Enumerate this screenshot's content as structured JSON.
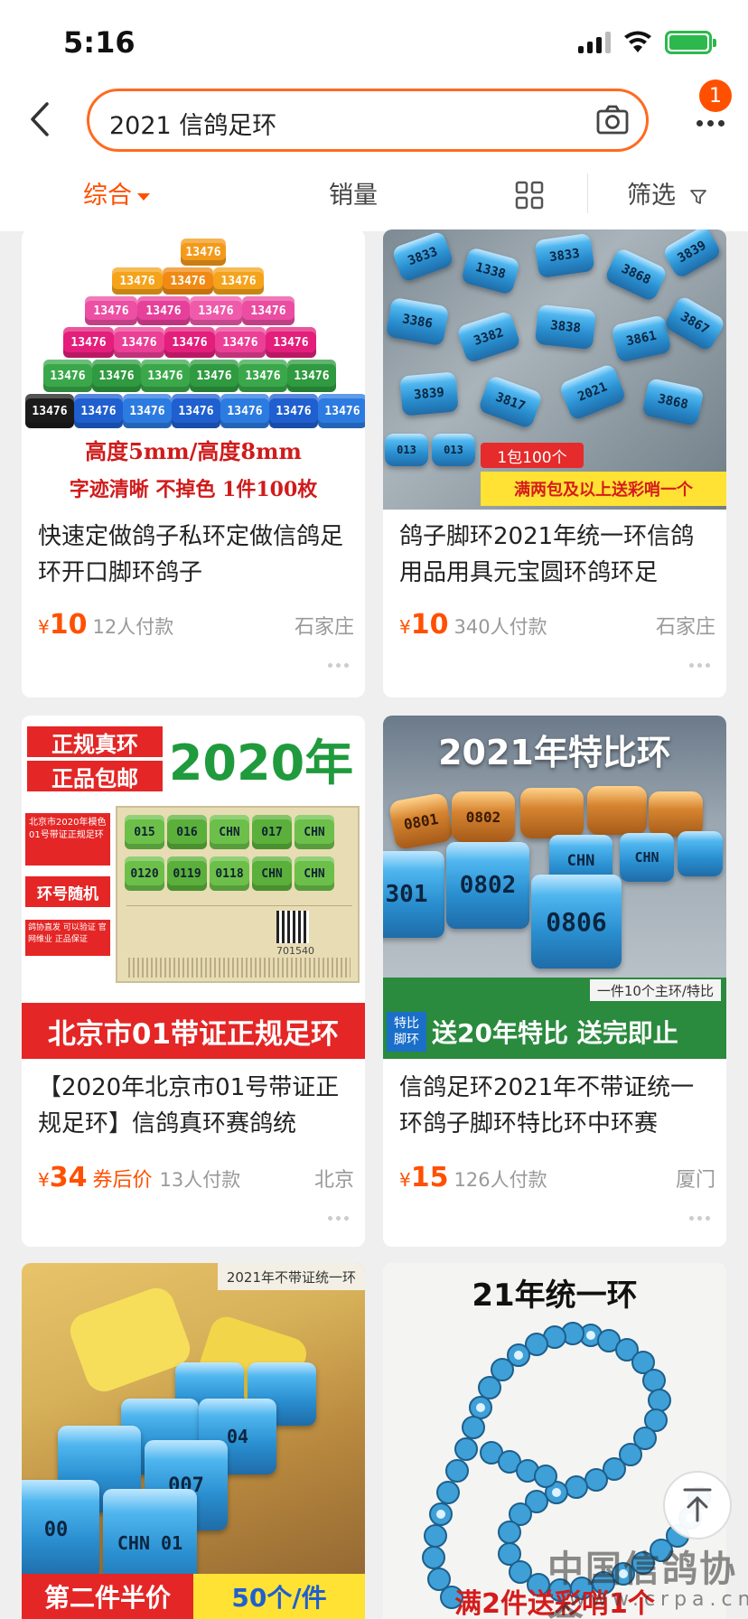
{
  "status_bar": {
    "time": "5:16"
  },
  "search": {
    "query": "2021 信鸽足环",
    "notification_count": "1"
  },
  "sort_bar": {
    "comprehensive": "综合",
    "sales": "销量",
    "filter": "筛选"
  },
  "products": [
    {
      "title": "快速定做鸽子私环定做信鸽足环开口脚环鸽子",
      "price_symbol": "¥",
      "price": "10",
      "coupon_label": "",
      "sales": "12人付款",
      "location": "石家庄",
      "image_text": {
        "line1": "高度5mm/高度8mm",
        "line2": "字迹清晰 不掉色 1件100枚",
        "ring_number": "13476"
      }
    },
    {
      "title": "鸽子脚环2021年统一环信鸽用品用具元宝圆环鸽环足",
      "price_symbol": "¥",
      "price": "10",
      "coupon_label": "",
      "sales": "340人付款",
      "location": "石家庄",
      "image_text": {
        "pack_label": "1包100个",
        "promo_banner": "满两包及以上送彩哨一个"
      }
    },
    {
      "title": "【2020年北京市01号带证正规足环】信鸽真环赛鸽统",
      "price_symbol": "¥",
      "price": "34",
      "coupon_label": "券后价",
      "sales": "13人付款",
      "location": "北京",
      "image_text": {
        "genuine_line1": "正规真环",
        "genuine_line2": "正品包邮",
        "year_headline": "2020年",
        "side_note1": "北京市2020年模色01号带证正规足环",
        "side_note2": "环号随机",
        "side_note3": "鸽协直发 可以验证 官网维业 正品保证",
        "bottom_banner": "北京市01带证正规足环",
        "cert_number": "701540"
      }
    },
    {
      "title": "信鸽足环2021年不带证统一环鸽子脚环特比环中环赛",
      "price_symbol": "¥",
      "price": "15",
      "coupon_label": "",
      "sales": "126人付款",
      "location": "厦门",
      "image_text": {
        "headline": "2021年特比环",
        "sub_note": "一件10个主环/特比",
        "tag": "特比脚环",
        "banner": "送20年特比 送完即止",
        "ring1": "0802",
        "ring2": "0806",
        "ring3": "301"
      }
    },
    {
      "title": "",
      "price_symbol": "",
      "price": "",
      "coupon_label": "",
      "sales": "",
      "location": "",
      "image_text": {
        "top_tag": "2021年不带证统一环",
        "banner_left": "第二件半价",
        "banner_right": "50个/件",
        "ring_text": "CHN 01",
        "ring_num": "007"
      }
    },
    {
      "title": "",
      "price_symbol": "",
      "price": "",
      "coupon_label": "",
      "sales": "",
      "location": "",
      "image_text": {
        "headline": "21年统一环",
        "bottom_promo": "满2件送彩哨1个"
      }
    }
  ],
  "watermark": {
    "cn": "中国信鸽协会",
    "url": "www.crpa.cn"
  },
  "colors": {
    "accent": "#ff5000",
    "search_border": "#ff6a1f"
  }
}
